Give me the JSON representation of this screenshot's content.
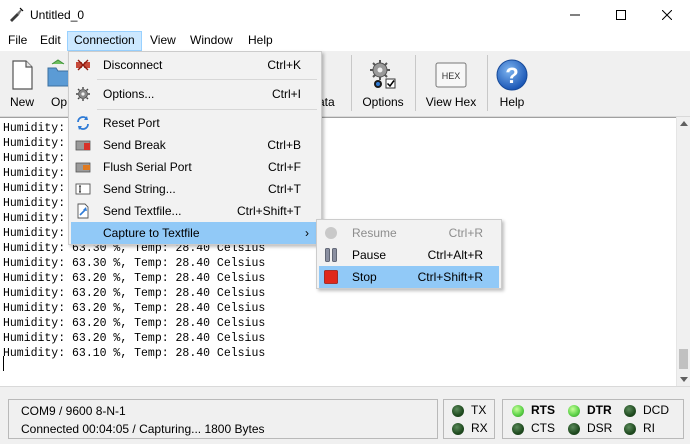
{
  "window": {
    "title": "Untitled_0"
  },
  "menubar": {
    "items": [
      "File",
      "Edit",
      "Connection",
      "View",
      "Window",
      "Help"
    ],
    "active": "Connection"
  },
  "toolbar": {
    "buttons": [
      {
        "label": "New",
        "icon": "new-document-icon"
      },
      {
        "label": "Op",
        "icon": "open-folder-icon"
      },
      {
        "label": "ata",
        "icon": "send-data-icon"
      },
      {
        "label": "Options",
        "icon": "gear-options-icon"
      },
      {
        "label": "View Hex",
        "icon": "hex-icon",
        "icon_text": "HEX"
      },
      {
        "label": "Help",
        "icon": "help-icon",
        "icon_text": "?"
      }
    ]
  },
  "terminal": {
    "lines": [
      "Humidity: ",
      "Humidity: ",
      "Humidity: ",
      "Humidity: ",
      "Humidity: ",
      "Humidity: ",
      "Humidity: ",
      "Humidity: ",
      "Humidity: 63.30 %, Temp: 28.40 Celsius",
      "Humidity: 63.30 %, Temp: 28.40 Celsius",
      "Humidity: 63.20 %, Temp: 28.40 Celsius",
      "Humidity: 63.20 %, Temp: 28.40 Celsius",
      "Humidity: 63.20 %, Temp: 28.40 Celsius",
      "Humidity: 63.20 %, Temp: 28.40 Celsius",
      "Humidity: 63.20 %, Temp: 28.40 Celsius",
      "Humidity: 63.10 %, Temp: 28.40 Celsius"
    ]
  },
  "connection_menu": {
    "items": [
      {
        "label": "Disconnect",
        "shortcut": "Ctrl+K",
        "icon": "disconnect-icon"
      },
      {
        "label": "Options...",
        "shortcut": "Ctrl+I",
        "icon": "gear-icon"
      },
      {
        "label": "Reset Port",
        "shortcut": "",
        "icon": "reset-icon"
      },
      {
        "label": "Send Break",
        "shortcut": "Ctrl+B",
        "icon": "send-break-icon"
      },
      {
        "label": "Flush Serial Port",
        "shortcut": "Ctrl+F",
        "icon": "flush-icon"
      },
      {
        "label": "Send String...",
        "shortcut": "Ctrl+T",
        "icon": "send-string-icon"
      },
      {
        "label": "Send Textfile...",
        "shortcut": "Ctrl+Shift+T",
        "icon": "send-textfile-icon"
      },
      {
        "label": "Capture to Textfile",
        "shortcut": "",
        "icon": "",
        "submenu_arrow": "›"
      }
    ]
  },
  "capture_submenu": {
    "items": [
      {
        "label": "Resume",
        "shortcut": "Ctrl+R",
        "icon": "resume-icon",
        "disabled": true
      },
      {
        "label": "Pause",
        "shortcut": "Ctrl+Alt+R",
        "icon": "pause-icon",
        "disabled": false
      },
      {
        "label": "Stop",
        "shortcut": "Ctrl+Shift+R",
        "icon": "stop-icon",
        "disabled": false
      }
    ]
  },
  "statusbar": {
    "port_settings": "COM9 / 9600 8-N-1",
    "connection_status": "Connected 00:04:05 / Capturing... 1800 Bytes",
    "indicators": {
      "TX": "off",
      "RX": "off",
      "RTS": "on",
      "CTS": "off",
      "DTR": "on",
      "DSR": "off",
      "DCD": "off",
      "RI": "off"
    },
    "labels": {
      "tx": "TX",
      "rx": "RX",
      "rts": "RTS",
      "cts": "CTS",
      "dtr": "DTR",
      "dsr": "DSR",
      "dcd": "DCD",
      "ri": "RI"
    }
  },
  "colors": {
    "menu_highlight": "#91c9f7",
    "active_menu": "#cce8ff",
    "led_on": "#5fd34a",
    "led_off": "#1f4a1f",
    "stop_red": "#e0281b"
  }
}
